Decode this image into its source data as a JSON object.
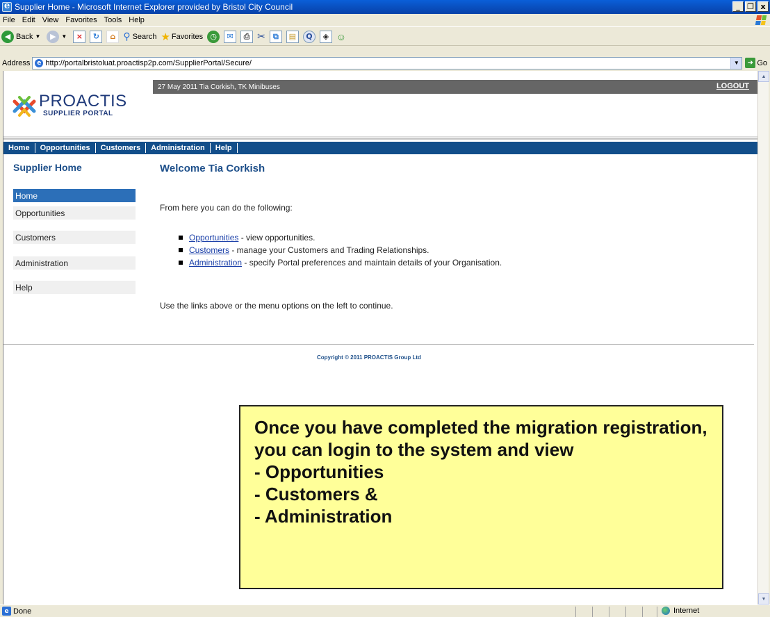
{
  "window": {
    "title": "Supplier Home - Microsoft Internet Explorer provided by Bristol City Council",
    "buttons": [
      "_",
      "ơ",
      "x"
    ]
  },
  "menubar": [
    "File",
    "Edit",
    "View",
    "Favorites",
    "Tools",
    "Help"
  ],
  "toolbar": {
    "back_label": "Back",
    "search_label": "Search",
    "favorites_label": "Favorites"
  },
  "address": {
    "label": "Address",
    "url": "http://portalbristoluat.proactisp2p.com/SupplierPortal/Secure/",
    "go_label": "Go"
  },
  "portal": {
    "logo_word": "PROACTIS",
    "logo_sub": "SUPPLIER PORTAL",
    "user_info": "27 May 2011   Tia Corkish, TK Minibuses",
    "logout_label": "LOGOUT",
    "nav": [
      "Home",
      "Opportunities",
      "Customers",
      "Administration",
      "Help"
    ],
    "sidebar_title": "Supplier Home",
    "sidebar_items": [
      "Home",
      "Opportunities",
      "Customers",
      "Administration",
      "Help"
    ],
    "welcome": "Welcome Tia Corkish",
    "intro": "From here you can do the following:",
    "bullets": [
      {
        "link": "Opportunities",
        "text": " - view opportunities."
      },
      {
        "link": "Customers",
        "text": " - manage your Customers and Trading Relationships."
      },
      {
        "link": "Administration",
        "text": " - specify Portal preferences and maintain details of your Organisation."
      }
    ],
    "outro": "Use the links above or the menu options on the left to continue.",
    "copyright": "Copyright © 2011 PROACTIS Group Ltd"
  },
  "callout": {
    "text": "Once you have completed the migration registration, you can login to the system and view\n- Opportunities\n- Customers &\n- Administration"
  },
  "status": {
    "text": "Done",
    "zone": "Internet"
  },
  "colors": {
    "nav_blue": "#124e8a",
    "title_blue": "#1d4f8a",
    "callout_yellow": "#ffff99"
  }
}
